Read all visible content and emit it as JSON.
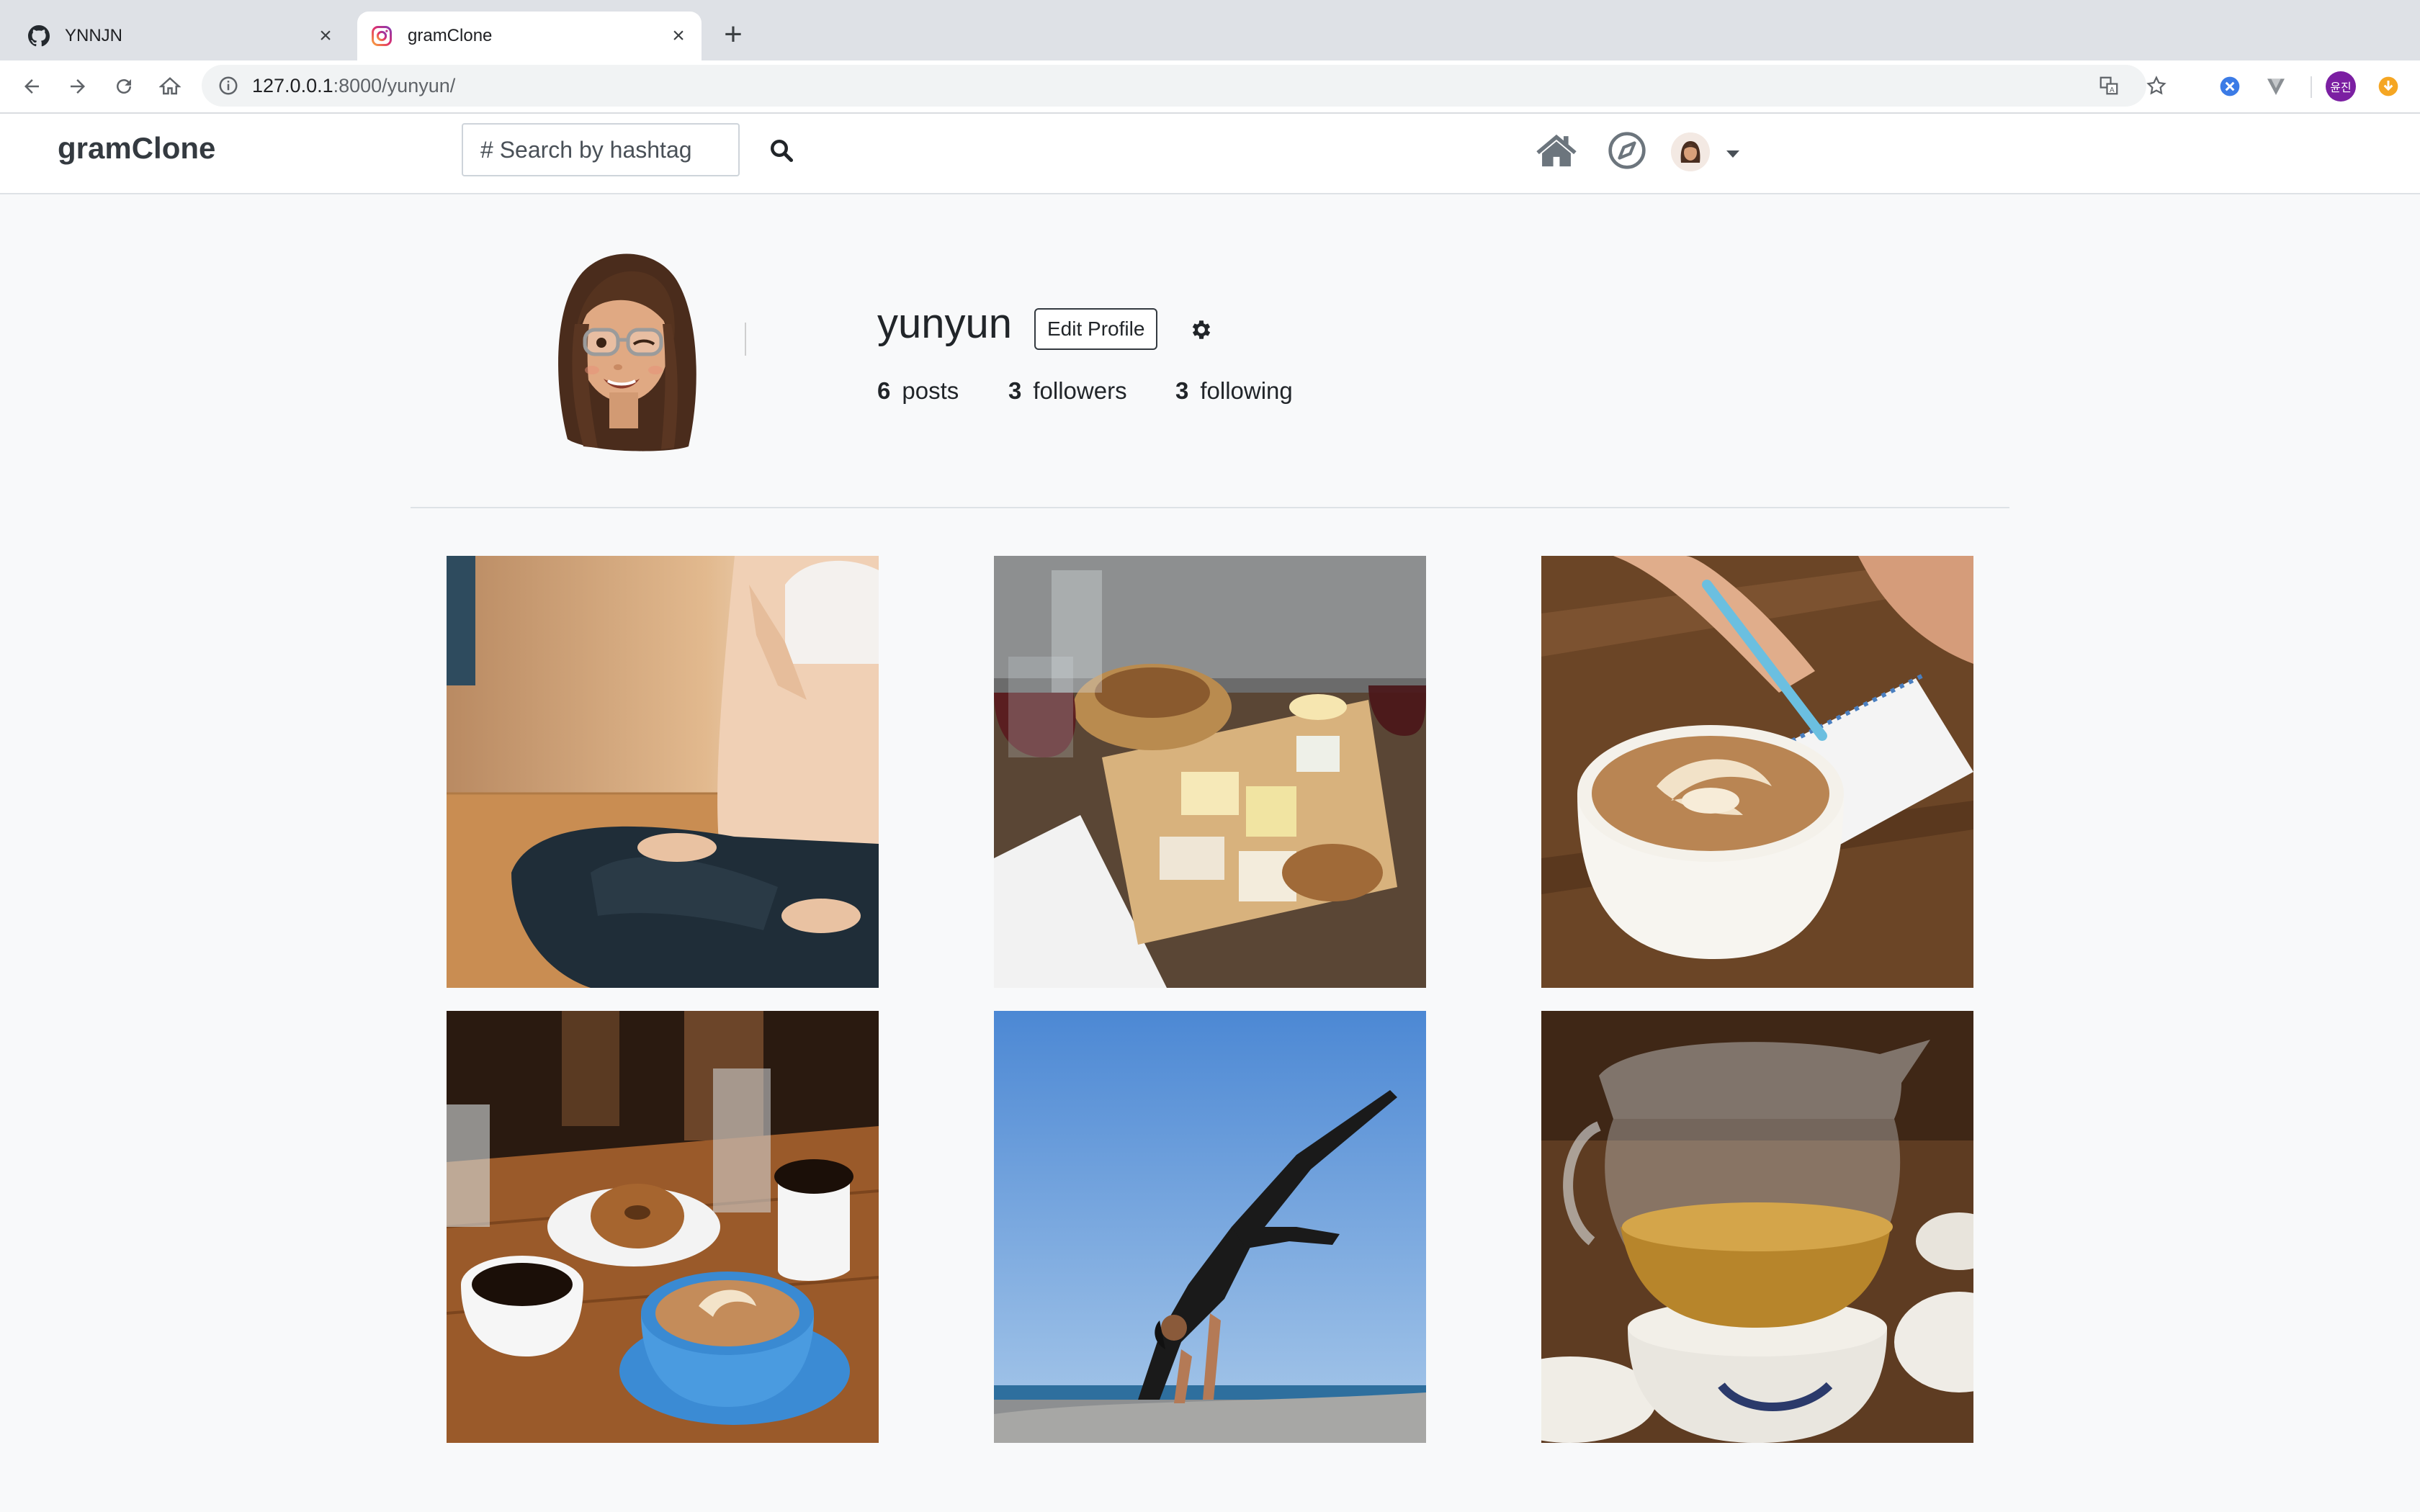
{
  "browser": {
    "tabs": [
      {
        "title": "YNNJN",
        "favicon": "github-icon",
        "active": false
      },
      {
        "title": "gramClone",
        "favicon": "instagram-icon",
        "active": true
      }
    ],
    "url_host": "127.0.0.1",
    "url_path": ":8000/yunyun/",
    "profile_initials": "윤진"
  },
  "app": {
    "brand": "gramClone",
    "search_placeholder": "# Search by hashtag",
    "nav_icons": [
      "home-icon",
      "compass-icon",
      "user-avatar",
      "caret-down-icon"
    ]
  },
  "profile": {
    "username": "yunyun",
    "edit_label": "Edit Profile",
    "stats": {
      "posts_count": "6",
      "posts_label": "posts",
      "followers_count": "3",
      "followers_label": "followers",
      "following_count": "3",
      "following_label": "following"
    }
  },
  "posts": [
    {
      "subject": "yoga-meditation-photo"
    },
    {
      "subject": "cheese-board-wine-photo"
    },
    {
      "subject": "latte-notebook-photo"
    },
    {
      "subject": "coffee-donut-table-photo"
    },
    {
      "subject": "yoga-beach-pose-photo"
    },
    {
      "subject": "tea-pitcher-photo"
    }
  ],
  "colors": {
    "page_bg": "#f8f9fa",
    "navbar_bg": "#ffffff",
    "brand_text": "#343a40",
    "icon_gray": "#6c757d"
  }
}
